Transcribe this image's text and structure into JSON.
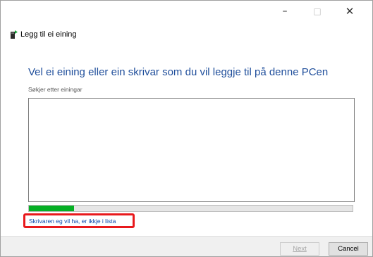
{
  "window": {
    "minimize_glyph": "–",
    "maximize_glyph": "□",
    "close_glyph": "✕"
  },
  "header": {
    "icon": "add-device-icon",
    "title": "Legg til ei eining"
  },
  "main": {
    "heading": "Vel ei eining eller ein skrivar som du vil leggje til på denne PCen",
    "status": "Søkjer etter einingar",
    "devices": [],
    "progress_fraction": 0.14,
    "progress_color": "#06b025",
    "missing_printer_link": "Skrivaren eg vil ha, er ikkje i lista",
    "highlight_color": "#e8191c"
  },
  "footer": {
    "next_label": "Next",
    "cancel_label": "Cancel"
  }
}
